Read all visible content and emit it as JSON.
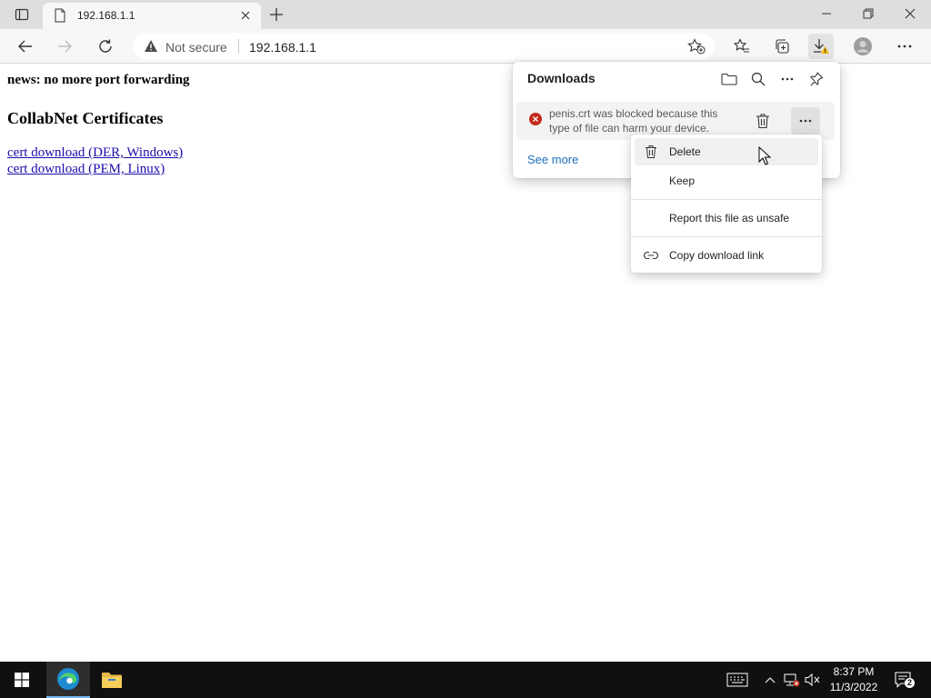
{
  "tab": {
    "title": "192.168.1.1"
  },
  "address": {
    "security_label": "Not secure",
    "url": "192.168.1.1"
  },
  "page": {
    "news": "news: no more port forwarding",
    "heading": "CollabNet Certificates",
    "links": [
      "cert download (DER, Windows)",
      "cert download (PEM, Linux)"
    ]
  },
  "downloads": {
    "title": "Downloads",
    "item": {
      "message": "penis.crt was blocked because this type of file can harm your device."
    },
    "see_more": "See more"
  },
  "context_menu": {
    "items": [
      "Delete",
      "Keep",
      "Report this file as unsafe",
      "Copy download link"
    ]
  },
  "clock": {
    "time": "8:37 PM",
    "date": "11/3/2022"
  },
  "notifications": {
    "count": "2"
  },
  "colors": {
    "link": "#1a0dab",
    "accent": "#1e6fb8",
    "error": "#c42b1c",
    "taskbar": "#101010"
  }
}
